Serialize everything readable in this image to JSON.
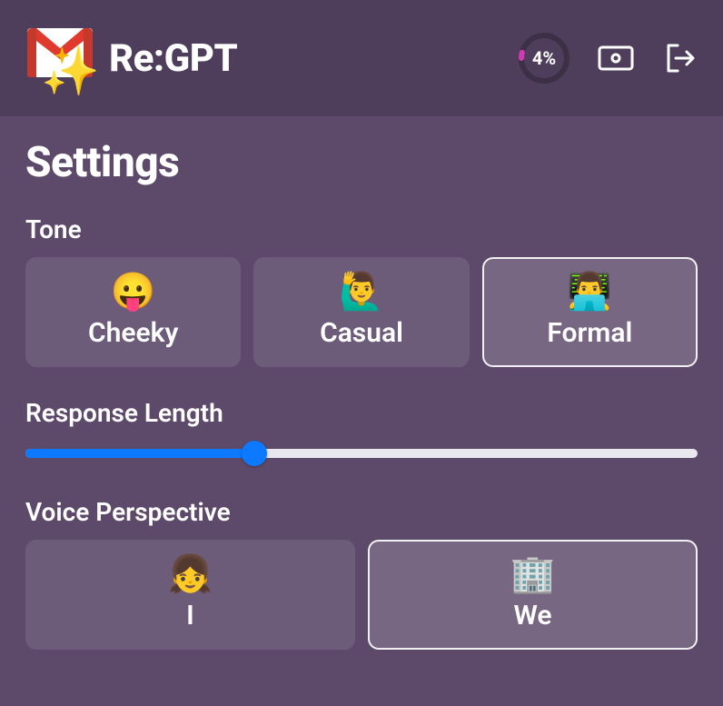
{
  "header": {
    "app_name": "Re:GPT",
    "progress": {
      "value": 4,
      "label": "4%"
    }
  },
  "page": {
    "title": "Settings"
  },
  "sections": {
    "tone": {
      "label": "Tone",
      "options": [
        {
          "emoji": "😛",
          "label": "Cheeky",
          "selected": false
        },
        {
          "emoji": "🙋‍♂️",
          "label": "Casual",
          "selected": false
        },
        {
          "emoji": "👨‍💻",
          "label": "Formal",
          "selected": true
        }
      ]
    },
    "response_length": {
      "label": "Response Length",
      "value_percent": 34
    },
    "voice": {
      "label": "Voice Perspective",
      "options": [
        {
          "emoji": "👧",
          "label": "I",
          "selected": false
        },
        {
          "emoji": "🏢",
          "label": "We",
          "selected": true
        }
      ]
    }
  },
  "colors": {
    "bg": "#5d4a6a",
    "header_bg": "#4f3e5b",
    "accent_blue": "#0d79ff",
    "progress_magenta": "#d13ab3"
  }
}
